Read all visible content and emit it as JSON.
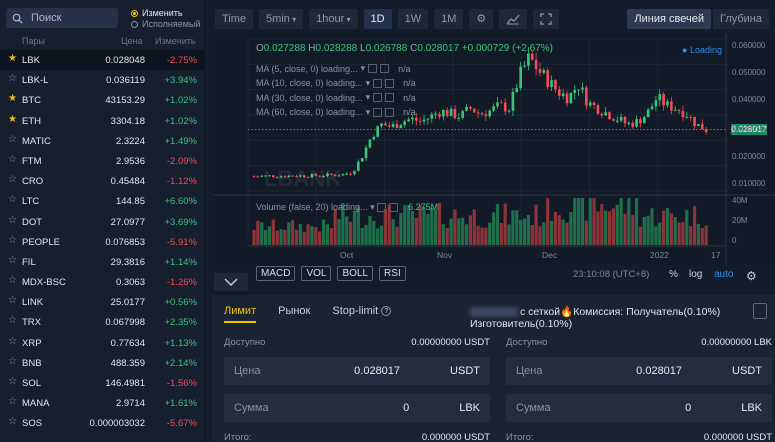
{
  "search": {
    "placeholder": "Поиск"
  },
  "toggle": {
    "change": "Изменить",
    "volume": "Исполняемый"
  },
  "list_headers": {
    "pair": "Пары",
    "price": "Цена",
    "change": "Изменить"
  },
  "pairs": [
    {
      "name": "LBK",
      "price": "0.028048",
      "change": "-2.75%",
      "fav": true
    },
    {
      "name": "LBK-L",
      "price": "0.036119",
      "change": "+3.94%",
      "fav": false
    },
    {
      "name": "BTC",
      "price": "43153.29",
      "change": "+1.02%",
      "fav": true
    },
    {
      "name": "ETH",
      "price": "3304.18",
      "change": "+1.02%",
      "fav": true
    },
    {
      "name": "MATIC",
      "price": "2.3224",
      "change": "+1.49%",
      "fav": false
    },
    {
      "name": "FTM",
      "price": "2.9536",
      "change": "-2.09%",
      "fav": false
    },
    {
      "name": "CRO",
      "price": "0.45484",
      "change": "-1.12%",
      "fav": false
    },
    {
      "name": "LTC",
      "price": "144.85",
      "change": "+6.60%",
      "fav": false
    },
    {
      "name": "DOT",
      "price": "27.0977",
      "change": "+3.69%",
      "fav": false
    },
    {
      "name": "PEOPLE",
      "price": "0.076853",
      "change": "-5.91%",
      "fav": false
    },
    {
      "name": "FIL",
      "price": "29.3816",
      "change": "+1.14%",
      "fav": false
    },
    {
      "name": "MDX-BSC",
      "price": "0.3063",
      "change": "-1.26%",
      "fav": false
    },
    {
      "name": "LINK",
      "price": "25.0177",
      "change": "+0.56%",
      "fav": false
    },
    {
      "name": "TRX",
      "price": "0.067998",
      "change": "+2.35%",
      "fav": false
    },
    {
      "name": "XRP",
      "price": "0.77634",
      "change": "+1.13%",
      "fav": false
    },
    {
      "name": "BNB",
      "price": "488.359",
      "change": "+2.14%",
      "fav": false
    },
    {
      "name": "SOL",
      "price": "146.4981",
      "change": "-1.56%",
      "fav": false
    },
    {
      "name": "MANA",
      "price": "2.9714",
      "change": "+1.61%",
      "fav": false
    },
    {
      "name": "SOS",
      "price": "0.000003032",
      "change": "-5.67%",
      "fav": false
    }
  ],
  "toolbar": {
    "time": "Time",
    "interval1": "5min",
    "interval2": "1hour",
    "d1": "1D",
    "w1": "1W",
    "m1": "1M"
  },
  "chart_tabs": {
    "candles": "Линия свечей",
    "depth": "Глубина"
  },
  "ohlc": {
    "o_lbl": "O",
    "o": "0.027288",
    "h_lbl": "H",
    "h": "0.028288",
    "l_lbl": "L",
    "l": "0.026788",
    "c_lbl": "C",
    "c": "0.028017",
    "chg": "+0.000729 (+2.67%)"
  },
  "ma": [
    "MA (5, close, 0) loading...",
    "MA (10, close, 0) loading...",
    "MA (30, close, 0) loading...",
    "MA (60, close, 0) loading..."
  ],
  "na": "n/a",
  "loading": "Loading",
  "price_tag": "0.028017",
  "yticks": [
    "0.060000",
    "0.050000",
    "0.040000",
    "0.030000",
    "0.020000",
    "0.010000"
  ],
  "xticks": [
    "Oct",
    "Nov",
    "Dec",
    "2022",
    "17"
  ],
  "vol_ticks": [
    "40M",
    "20M",
    "0"
  ],
  "volume_label": "Volume (false, 20) loading...",
  "volume_value": "6.275M",
  "indicators": [
    "MACD",
    "VOL",
    "BOLL",
    "RSI"
  ],
  "timestamp": "23:10:08 (UTC+8)",
  "axis_opts": {
    "pct": "%",
    "log": "log",
    "auto": "auto"
  },
  "order_tabs": {
    "limit": "Лимит",
    "market": "Рынок",
    "stop": "Stop-limit"
  },
  "fee": {
    "grid": "с сеткой",
    "text": "Комиссия: Получатель(0.10%) Изготовитель(0.10%)"
  },
  "buy": {
    "avail_lbl": "Доступно",
    "avail": "0.00000000 USDT",
    "price_lbl": "Цена",
    "price": "0.028017",
    "price_unit": "USDT",
    "amount_lbl": "Сумма",
    "amount": "0",
    "amount_unit": "LBK",
    "total_lbl": "Итого:",
    "total": "0.000000 USDT"
  },
  "sell": {
    "avail_lbl": "Доступно",
    "avail": "0.00000000 LBK",
    "price_lbl": "Цена",
    "price": "0.028017",
    "price_unit": "USDT",
    "amount_lbl": "Сумма",
    "amount": "0",
    "amount_unit": "LBK",
    "total_lbl": "Итого:",
    "total": "0.000000 USDT"
  },
  "colors": {
    "up": "#3cc47c",
    "down": "#ef4d5a",
    "accent": "#f3c400",
    "blue": "#2d8ef0"
  },
  "chart_data": {
    "type": "candlestick",
    "ylim": [
      0.005,
      0.062
    ],
    "close_trend": [
      0.0105,
      0.0106,
      0.0107,
      0.0106,
      0.0108,
      0.0107,
      0.0108,
      0.0109,
      0.011,
      0.0112,
      0.012,
      0.018,
      0.026,
      0.03,
      0.029,
      0.031,
      0.032,
      0.031,
      0.033,
      0.035,
      0.034,
      0.033,
      0.036,
      0.034,
      0.035,
      0.037,
      0.036,
      0.048,
      0.055,
      0.05,
      0.046,
      0.042,
      0.04,
      0.045,
      0.038,
      0.036,
      0.034,
      0.032,
      0.03,
      0.031,
      0.034,
      0.04,
      0.037,
      0.036,
      0.034,
      0.03,
      0.028
    ]
  }
}
